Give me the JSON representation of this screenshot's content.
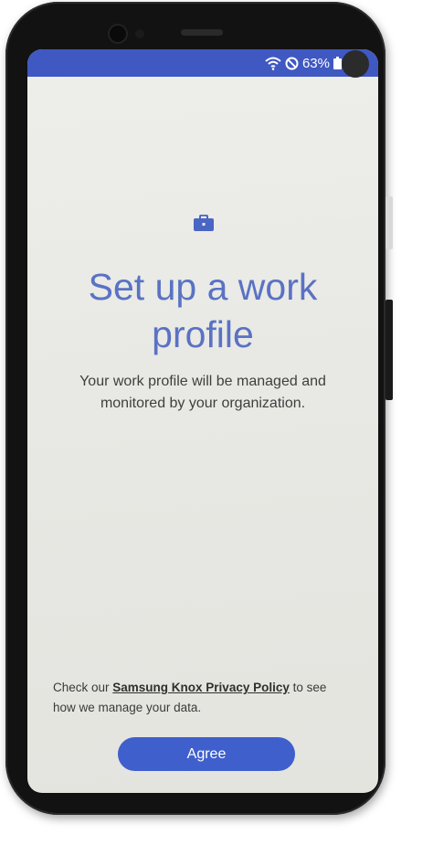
{
  "status_bar": {
    "icons": [
      "wifi-icon",
      "do-not-disturb-icon",
      "battery-icon"
    ],
    "battery_percent": "63%",
    "color": "#3f58c2"
  },
  "main": {
    "icon": "briefcase-icon",
    "title": "Set up a work profile",
    "subtitle": "Your work profile will be managed and monitored by your organization."
  },
  "footer": {
    "policy_prefix": "Check our ",
    "policy_link": "Samsung Knox Privacy Policy",
    "policy_suffix": " to see how we manage your data."
  },
  "actions": {
    "agree_label": "Agree",
    "accent_color": "#3f5fcc"
  }
}
